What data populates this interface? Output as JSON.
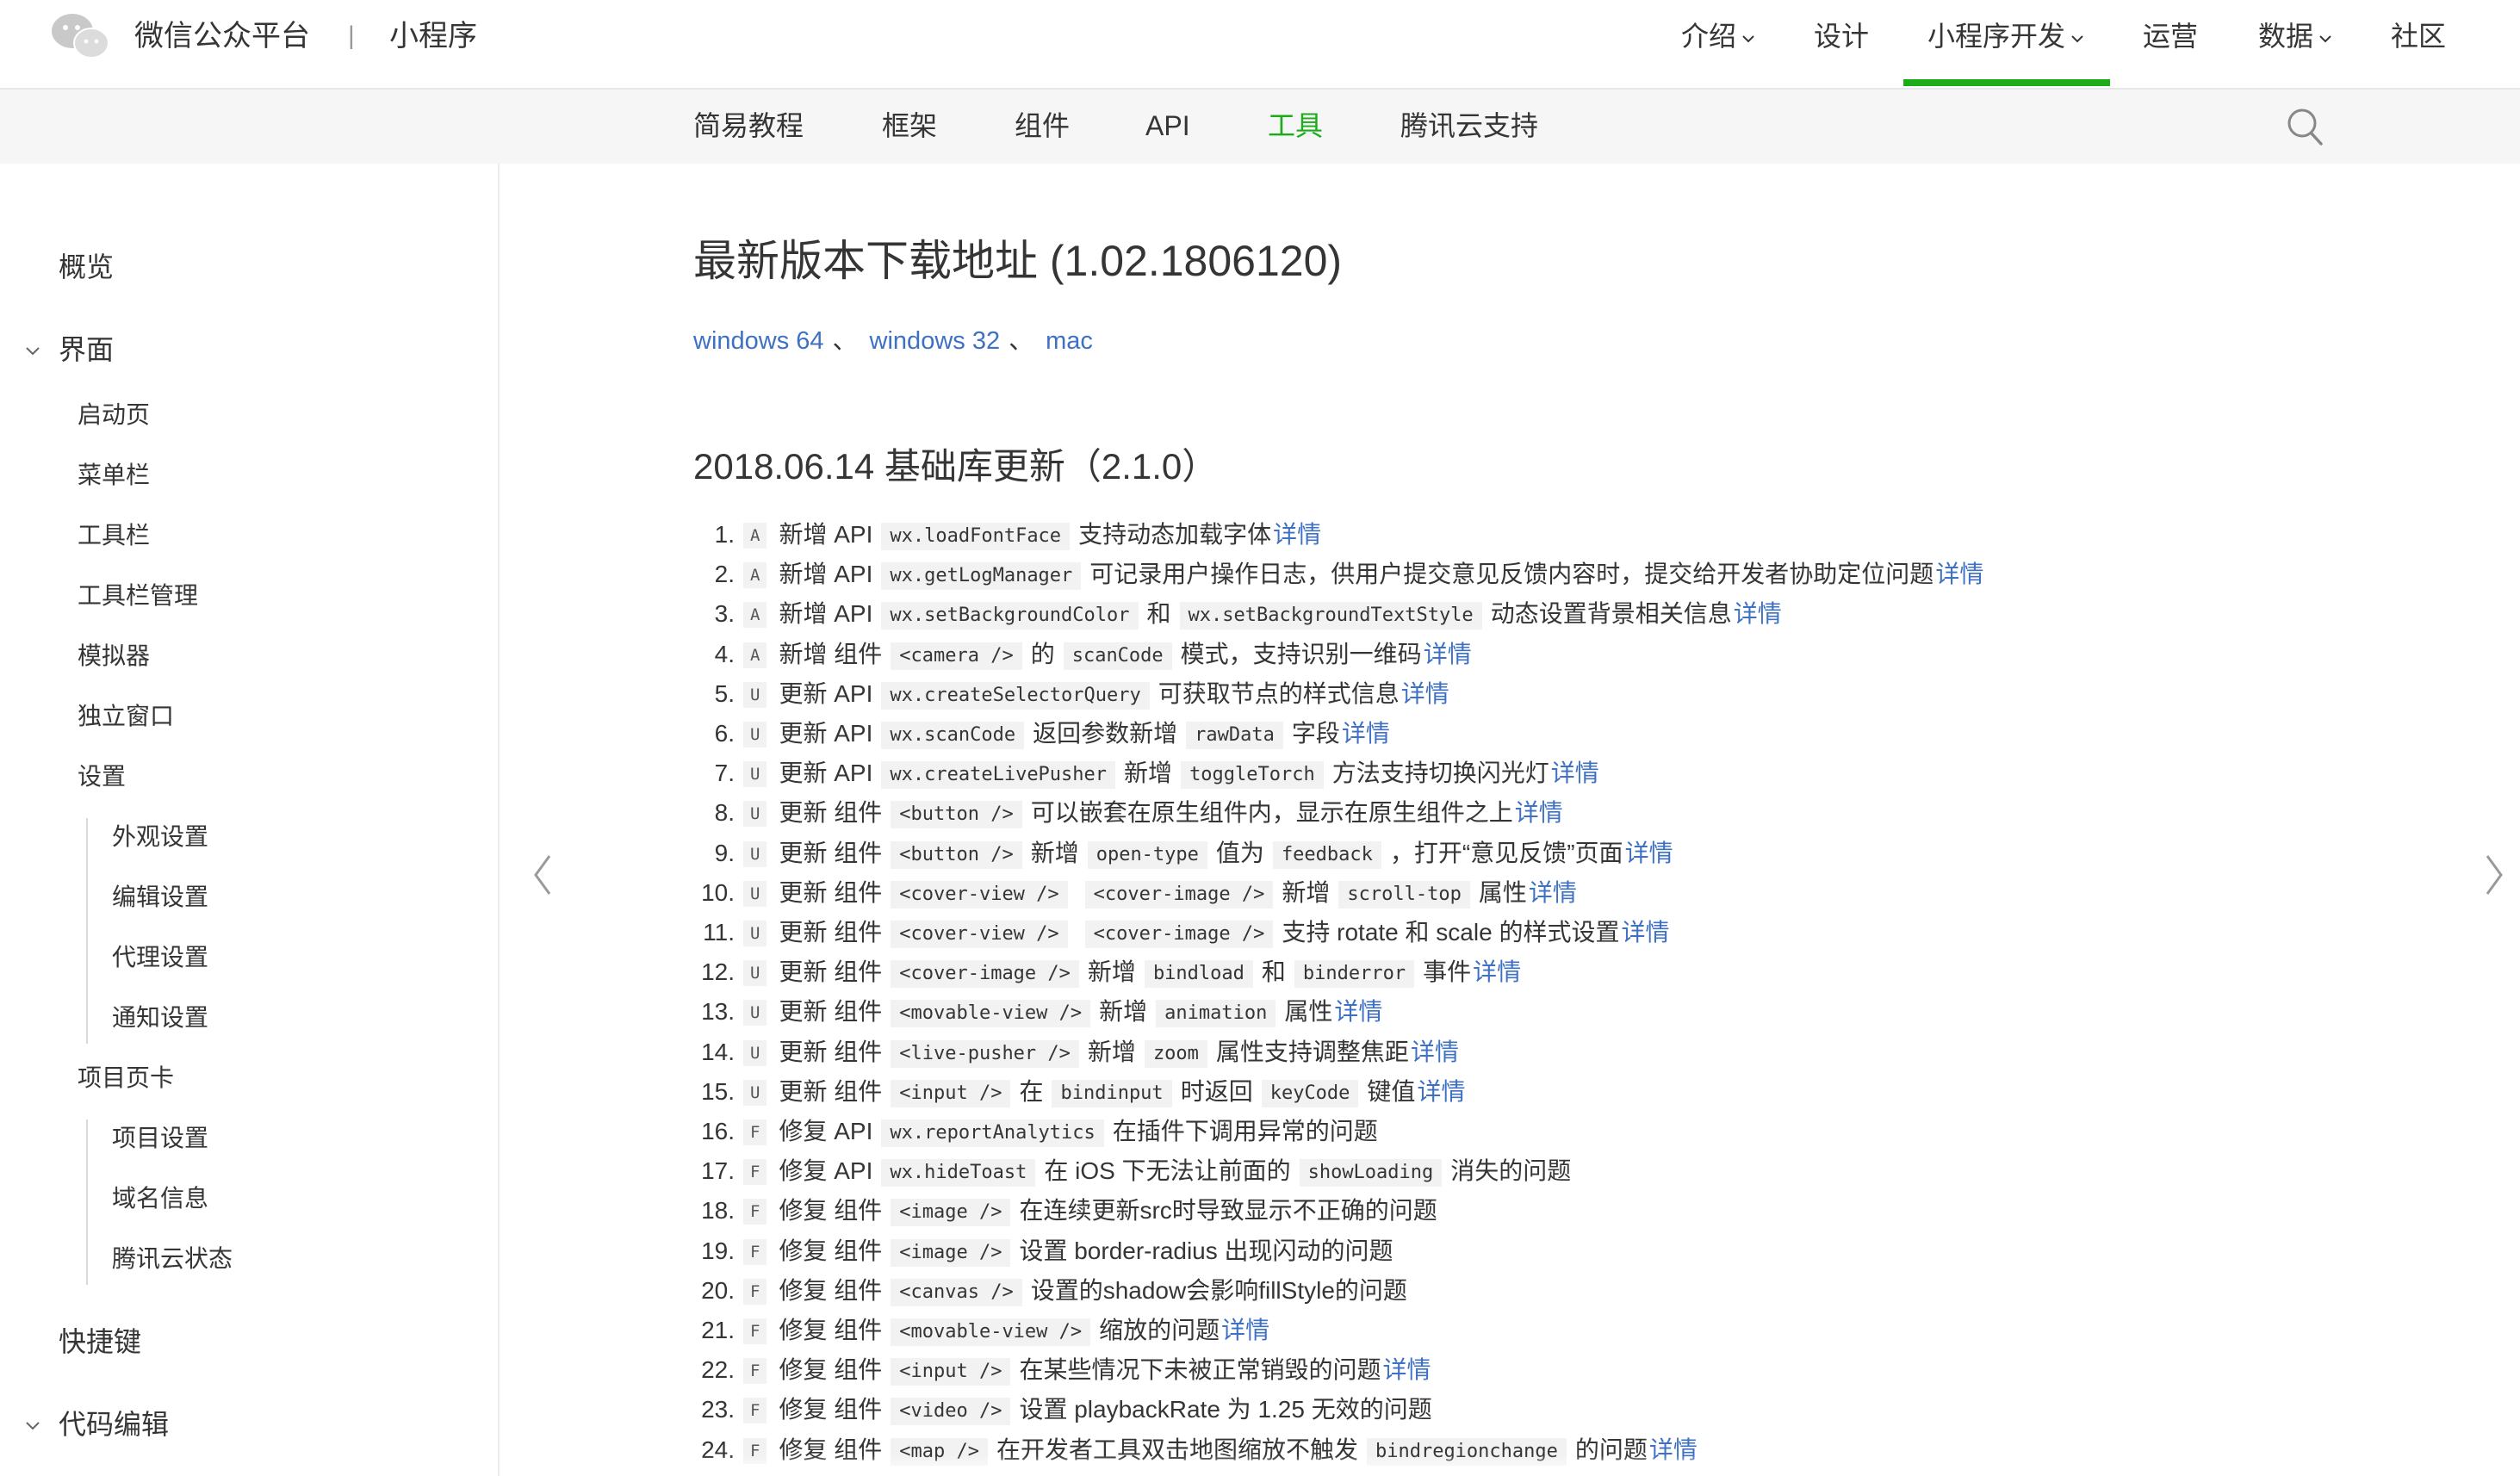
{
  "header": {
    "brand": "微信公众平台",
    "separator": "|",
    "product": "小程序",
    "nav": [
      {
        "label": "介绍",
        "dropdown": true
      },
      {
        "label": "设计",
        "dropdown": false
      },
      {
        "label": "小程序开发",
        "dropdown": true,
        "active": true
      },
      {
        "label": "运营",
        "dropdown": false
      },
      {
        "label": "数据",
        "dropdown": true
      },
      {
        "label": "社区",
        "dropdown": false
      }
    ]
  },
  "subnav": {
    "items": [
      {
        "label": "简易教程"
      },
      {
        "label": "框架"
      },
      {
        "label": "组件"
      },
      {
        "label": "API"
      },
      {
        "label": "工具",
        "active": true
      },
      {
        "label": "腾讯云支持"
      }
    ],
    "search_icon": "search-icon"
  },
  "sidebar": {
    "items": [
      {
        "label": "概览",
        "level": 0
      },
      {
        "label": "界面",
        "level": 0,
        "expanded": true
      },
      {
        "label": "启动页",
        "level": 1
      },
      {
        "label": "菜单栏",
        "level": 1
      },
      {
        "label": "工具栏",
        "level": 1
      },
      {
        "label": "工具栏管理",
        "level": 1
      },
      {
        "label": "模拟器",
        "level": 1
      },
      {
        "label": "独立窗口",
        "level": 1
      },
      {
        "label": "设置",
        "level": 1
      },
      {
        "label": "外观设置",
        "level": 2
      },
      {
        "label": "编辑设置",
        "level": 2
      },
      {
        "label": "代理设置",
        "level": 2
      },
      {
        "label": "通知设置",
        "level": 2
      },
      {
        "label": "项目页卡",
        "level": 1
      },
      {
        "label": "项目设置",
        "level": 2
      },
      {
        "label": "域名信息",
        "level": 2
      },
      {
        "label": "腾讯云状态",
        "level": 2
      },
      {
        "label": "快捷键",
        "level": 0
      },
      {
        "label": "代码编辑",
        "level": 0,
        "expanded": true
      }
    ]
  },
  "main": {
    "title": "最新版本下载地址 (1.02.1806120)",
    "downloads": [
      {
        "label": "windows 64"
      },
      {
        "label": "windows 32"
      },
      {
        "label": "mac"
      }
    ],
    "download_separator": "、",
    "section_title": "2018.06.14 基础库更新（2.1.0）",
    "changelog": [
      {
        "num": "1.",
        "badge": "A",
        "segs": [
          {
            "t": "text",
            "v": "新增 API"
          },
          {
            "t": "code",
            "v": "wx.loadFontFace"
          },
          {
            "t": "text",
            "v": "支持动态加载字体"
          },
          {
            "t": "link",
            "v": "详情"
          }
        ]
      },
      {
        "num": "2.",
        "badge": "A",
        "segs": [
          {
            "t": "text",
            "v": "新增 API"
          },
          {
            "t": "code",
            "v": "wx.getLogManager"
          },
          {
            "t": "text",
            "v": "可记录用户操作日志，供用户提交意见反馈内容时，提交给开发者协助定位问题"
          },
          {
            "t": "link",
            "v": "详情"
          }
        ]
      },
      {
        "num": "3.",
        "badge": "A",
        "segs": [
          {
            "t": "text",
            "v": "新增 API"
          },
          {
            "t": "code",
            "v": "wx.setBackgroundColor"
          },
          {
            "t": "text",
            "v": "和"
          },
          {
            "t": "code",
            "v": "wx.setBackgroundTextStyle"
          },
          {
            "t": "text",
            "v": "动态设置背景相关信息"
          },
          {
            "t": "link",
            "v": "详情"
          }
        ]
      },
      {
        "num": "4.",
        "badge": "A",
        "segs": [
          {
            "t": "text",
            "v": "新增 组件"
          },
          {
            "t": "code",
            "v": "<camera />"
          },
          {
            "t": "text",
            "v": "的"
          },
          {
            "t": "code",
            "v": "scanCode"
          },
          {
            "t": "text",
            "v": "模式，支持识别一维码"
          },
          {
            "t": "link",
            "v": "详情"
          }
        ]
      },
      {
        "num": "5.",
        "badge": "U",
        "segs": [
          {
            "t": "text",
            "v": "更新 API"
          },
          {
            "t": "code",
            "v": "wx.createSelectorQuery"
          },
          {
            "t": "text",
            "v": "可获取节点的样式信息"
          },
          {
            "t": "link",
            "v": "详情"
          }
        ]
      },
      {
        "num": "6.",
        "badge": "U",
        "segs": [
          {
            "t": "text",
            "v": "更新 API"
          },
          {
            "t": "code",
            "v": "wx.scanCode"
          },
          {
            "t": "text",
            "v": "返回参数新增"
          },
          {
            "t": "code",
            "v": "rawData"
          },
          {
            "t": "text",
            "v": "字段"
          },
          {
            "t": "link",
            "v": "详情"
          }
        ]
      },
      {
        "num": "7.",
        "badge": "U",
        "segs": [
          {
            "t": "text",
            "v": "更新 API"
          },
          {
            "t": "code",
            "v": "wx.createLivePusher"
          },
          {
            "t": "text",
            "v": "新增"
          },
          {
            "t": "code",
            "v": "toggleTorch"
          },
          {
            "t": "text",
            "v": "方法支持切换闪光灯"
          },
          {
            "t": "link",
            "v": "详情"
          }
        ]
      },
      {
        "num": "8.",
        "badge": "U",
        "segs": [
          {
            "t": "text",
            "v": "更新 组件"
          },
          {
            "t": "code",
            "v": "<button />"
          },
          {
            "t": "text",
            "v": "可以嵌套在原生组件内，显示在原生组件之上"
          },
          {
            "t": "link",
            "v": "详情"
          }
        ]
      },
      {
        "num": "9.",
        "badge": "U",
        "segs": [
          {
            "t": "text",
            "v": "更新 组件"
          },
          {
            "t": "code",
            "v": "<button />"
          },
          {
            "t": "text",
            "v": "新增"
          },
          {
            "t": "code",
            "v": "open-type"
          },
          {
            "t": "text",
            "v": "值为"
          },
          {
            "t": "code",
            "v": "feedback"
          },
          {
            "t": "text",
            "v": "，打开“意见反馈”页面"
          },
          {
            "t": "link",
            "v": "详情"
          }
        ]
      },
      {
        "num": "10.",
        "badge": "U",
        "segs": [
          {
            "t": "text",
            "v": "更新 组件"
          },
          {
            "t": "code",
            "v": "<cover-view />"
          },
          {
            "t": "code",
            "v": "<cover-image />"
          },
          {
            "t": "text",
            "v": "新增"
          },
          {
            "t": "code",
            "v": "scroll-top"
          },
          {
            "t": "text",
            "v": "属性"
          },
          {
            "t": "link",
            "v": "详情"
          }
        ]
      },
      {
        "num": "11.",
        "badge": "U",
        "segs": [
          {
            "t": "text",
            "v": "更新 组件"
          },
          {
            "t": "code",
            "v": "<cover-view />"
          },
          {
            "t": "code",
            "v": "<cover-image />"
          },
          {
            "t": "text",
            "v": "支持 rotate 和 scale 的样式设置"
          },
          {
            "t": "link",
            "v": "详情"
          }
        ]
      },
      {
        "num": "12.",
        "badge": "U",
        "segs": [
          {
            "t": "text",
            "v": "更新 组件"
          },
          {
            "t": "code",
            "v": "<cover-image />"
          },
          {
            "t": "text",
            "v": "新增"
          },
          {
            "t": "code",
            "v": "bindload"
          },
          {
            "t": "text",
            "v": "和"
          },
          {
            "t": "code",
            "v": "binderror"
          },
          {
            "t": "text",
            "v": "事件"
          },
          {
            "t": "link",
            "v": "详情"
          }
        ]
      },
      {
        "num": "13.",
        "badge": "U",
        "segs": [
          {
            "t": "text",
            "v": "更新 组件"
          },
          {
            "t": "code",
            "v": "<movable-view />"
          },
          {
            "t": "text",
            "v": "新增"
          },
          {
            "t": "code",
            "v": "animation"
          },
          {
            "t": "text",
            "v": "属性"
          },
          {
            "t": "link",
            "v": "详情"
          }
        ]
      },
      {
        "num": "14.",
        "badge": "U",
        "segs": [
          {
            "t": "text",
            "v": "更新 组件"
          },
          {
            "t": "code",
            "v": "<live-pusher />"
          },
          {
            "t": "text",
            "v": "新增"
          },
          {
            "t": "code",
            "v": "zoom"
          },
          {
            "t": "text",
            "v": "属性支持调整焦距"
          },
          {
            "t": "link",
            "v": "详情"
          }
        ]
      },
      {
        "num": "15.",
        "badge": "U",
        "segs": [
          {
            "t": "text",
            "v": "更新 组件"
          },
          {
            "t": "code",
            "v": "<input />"
          },
          {
            "t": "text",
            "v": "在"
          },
          {
            "t": "code",
            "v": "bindinput"
          },
          {
            "t": "text",
            "v": "时返回"
          },
          {
            "t": "code",
            "v": "keyCode"
          },
          {
            "t": "text",
            "v": "键值"
          },
          {
            "t": "link",
            "v": "详情"
          }
        ]
      },
      {
        "num": "16.",
        "badge": "F",
        "segs": [
          {
            "t": "text",
            "v": "修复 API"
          },
          {
            "t": "code",
            "v": "wx.reportAnalytics"
          },
          {
            "t": "text",
            "v": "在插件下调用异常的问题"
          }
        ]
      },
      {
        "num": "17.",
        "badge": "F",
        "segs": [
          {
            "t": "text",
            "v": "修复 API"
          },
          {
            "t": "code",
            "v": "wx.hideToast"
          },
          {
            "t": "text",
            "v": "在 iOS 下无法让前面的"
          },
          {
            "t": "code",
            "v": "showLoading"
          },
          {
            "t": "text",
            "v": "消失的问题"
          }
        ]
      },
      {
        "num": "18.",
        "badge": "F",
        "segs": [
          {
            "t": "text",
            "v": "修复 组件"
          },
          {
            "t": "code",
            "v": "<image />"
          },
          {
            "t": "text",
            "v": "在连续更新src时导致显示不正确的问题"
          }
        ]
      },
      {
        "num": "19.",
        "badge": "F",
        "segs": [
          {
            "t": "text",
            "v": "修复 组件"
          },
          {
            "t": "code",
            "v": "<image />"
          },
          {
            "t": "text",
            "v": "设置 border-radius 出现闪动的问题"
          }
        ]
      },
      {
        "num": "20.",
        "badge": "F",
        "segs": [
          {
            "t": "text",
            "v": "修复 组件"
          },
          {
            "t": "code",
            "v": "<canvas />"
          },
          {
            "t": "text",
            "v": "设置的shadow会影响fillStyle的问题"
          }
        ]
      },
      {
        "num": "21.",
        "badge": "F",
        "segs": [
          {
            "t": "text",
            "v": "修复 组件"
          },
          {
            "t": "code",
            "v": "<movable-view />"
          },
          {
            "t": "text",
            "v": "缩放的问题"
          },
          {
            "t": "link",
            "v": "详情"
          }
        ]
      },
      {
        "num": "22.",
        "badge": "F",
        "segs": [
          {
            "t": "text",
            "v": "修复 组件"
          },
          {
            "t": "code",
            "v": "<input />"
          },
          {
            "t": "text",
            "v": "在某些情况下未被正常销毁的问题"
          },
          {
            "t": "link",
            "v": "详情"
          }
        ]
      },
      {
        "num": "23.",
        "badge": "F",
        "segs": [
          {
            "t": "text",
            "v": "修复 组件"
          },
          {
            "t": "code",
            "v": "<video />"
          },
          {
            "t": "text",
            "v": "设置 playbackRate 为 1.25 无效的问题"
          }
        ]
      },
      {
        "num": "24.",
        "badge": "F",
        "segs": [
          {
            "t": "text",
            "v": "修复 组件"
          },
          {
            "t": "code",
            "v": "<map />"
          },
          {
            "t": "text",
            "v": "在开发者工具双击地图缩放不触发"
          },
          {
            "t": "code",
            "v": "bindregionchange"
          },
          {
            "t": "text",
            "v": "的问题"
          },
          {
            "t": "link",
            "v": "详情"
          }
        ]
      }
    ]
  },
  "icons": {
    "logo": "wechat-logo-icon",
    "prev": "chevron-left-icon",
    "next": "chevron-right-icon"
  },
  "colors": {
    "accent": "#1aad19",
    "link": "#3e71c4",
    "text": "#353535",
    "subbar_bg": "#f6f6f6"
  }
}
